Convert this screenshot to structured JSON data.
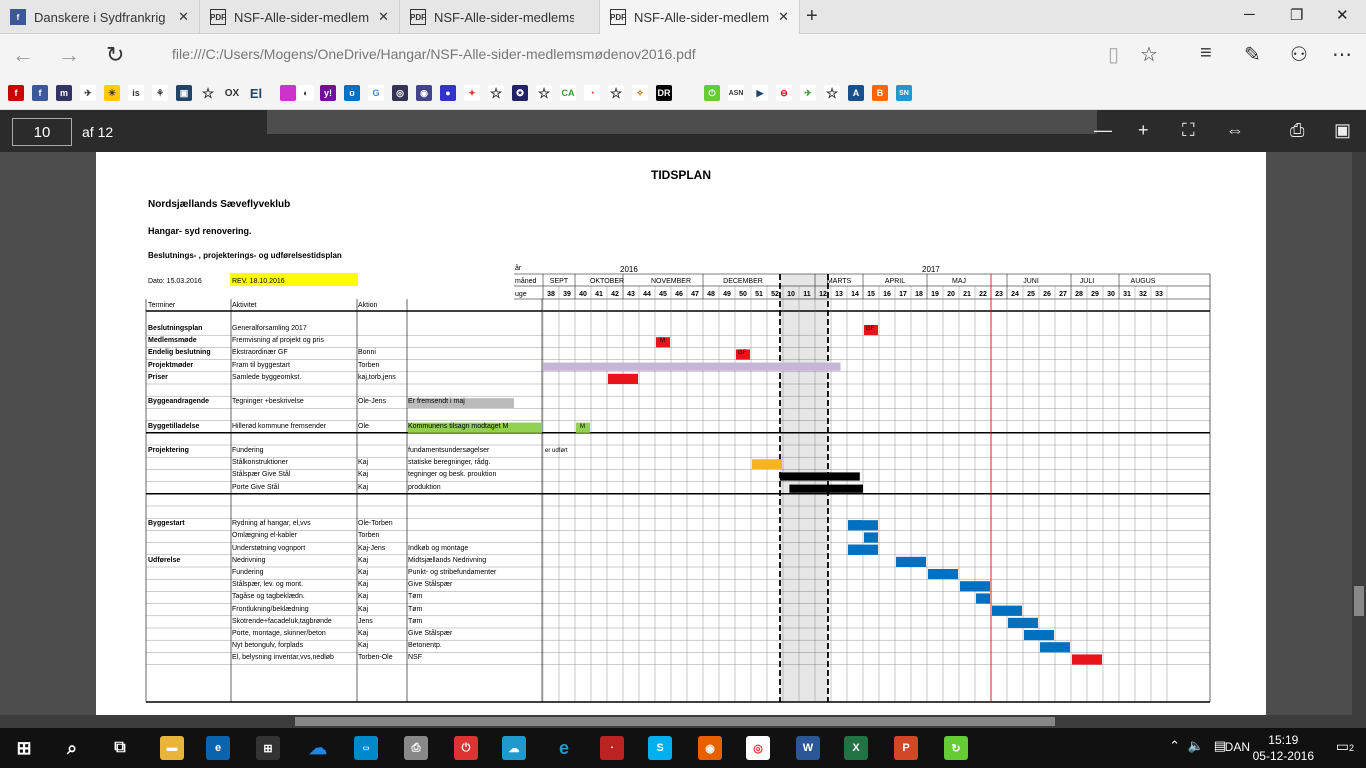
{
  "browser": {
    "tabs": [
      {
        "label": "Danskere i Sydfrankrig",
        "icon": "facebook-icon"
      },
      {
        "label": "NSF-Alle-sider-medlem",
        "icon": "pdf-icon"
      },
      {
        "label": "NSF-Alle-sider-medlemsmø",
        "icon": "pdf-icon"
      },
      {
        "label": "NSF-Alle-sider-medlem",
        "icon": "pdf-icon"
      }
    ],
    "url": "file:///C:/Users/Mogens/OneDrive/Hangar/NSF-Alle-sider-medlemsmødenov2016.pdf"
  },
  "pdf": {
    "page": "10",
    "of": "af 12"
  },
  "doc": {
    "title": "TIDSPLAN",
    "club": "Nordsjællands Sæveflyveklub",
    "project": "Hangar- syd renovering.",
    "subtitle": "Beslutnings- , projekterings- og udførelsestidsplan",
    "date": "Dato: 15.03.2016",
    "rev": "REV. 18.10.2016",
    "hdr_year": "år",
    "hdr_month": "måned",
    "hdr_week": "uge",
    "year_2016": "2016",
    "year_2017": "2017",
    "col_termin": "Terminer",
    "col_aktivitet": "Aktivitet",
    "col_aktion": "Aktion",
    "months": [
      "SEPT",
      "OKTOBER",
      "NOVEMBER",
      "DECEMBER",
      "MARTS",
      "APRIL",
      "MAJ",
      "JUNI",
      "JULI",
      "AUGUS"
    ],
    "weeks": [
      "38",
      "39",
      "40",
      "41",
      "42",
      "43",
      "44",
      "45",
      "46",
      "47",
      "48",
      "49",
      "50",
      "51",
      "52",
      "10",
      "11",
      "12",
      "13",
      "14",
      "15",
      "16",
      "17",
      "18",
      "19",
      "20",
      "21",
      "22",
      "23",
      "24",
      "25",
      "26",
      "27",
      "28",
      "29",
      "30",
      "31",
      "32",
      "33"
    ],
    "rows": [
      {
        "t": "Beslutningsplan",
        "a": "Generalforsamling 2017",
        "k": "",
        "n": ""
      },
      {
        "t": "Medlemsmøde",
        "a": "Fremvisning af projekt og pris",
        "k": "",
        "n": ""
      },
      {
        "t": "Endelig beslutning",
        "a": "Ekstraordinær GF",
        "k": "Bonni",
        "n": ""
      },
      {
        "t": "Projektmøder",
        "a": "Fram til byggestart",
        "k": "Torben",
        "n": ""
      },
      {
        "t": "Priser",
        "a": "Samlede byggeomkst.",
        "k": "kaj,torb,jens",
        "n": ""
      },
      {
        "t": "",
        "a": "",
        "k": "",
        "n": ""
      },
      {
        "t": "Byggeandragende",
        "a": "Tegninger +beskrivelse",
        "k": "Ole-Jens",
        "n": "Er fremsendt i maj"
      },
      {
        "t": "",
        "a": "",
        "k": "",
        "n": ""
      },
      {
        "t": "Byggetilladelse",
        "a": "Hillerød kommune fremsender",
        "k": "Ole",
        "n": "Kommunens tilsagn modtaget M"
      },
      {
        "t": "",
        "a": "",
        "k": "",
        "n": ""
      },
      {
        "t": "Projektering",
        "a": "Fundering",
        "k": "",
        "n": "fundamentsundersøgelser"
      },
      {
        "t": "",
        "a": "Stålkonstruktioner",
        "k": "Kaj",
        "n": "statiske beregninger, rådg."
      },
      {
        "t": "",
        "a": "Stålspær Give Stål",
        "k": "Kaj",
        "n": "tegninger og besk. prouktion"
      },
      {
        "t": "",
        "a": "Porte Give Stål",
        "k": "Kaj",
        "n": "produktion"
      },
      {
        "t": "",
        "a": "",
        "k": "",
        "n": ""
      },
      {
        "t": "",
        "a": "",
        "k": "",
        "n": ""
      },
      {
        "t": "Byggestart",
        "a": "Rydning af hangar, el,vvs",
        "k": "Ole-Torben",
        "n": ""
      },
      {
        "t": "",
        "a": "Omlægning el-kabler",
        "k": "Torben",
        "n": ""
      },
      {
        "t": "",
        "a": "Understøtning vognport",
        "k": "Kaj-Jens",
        "n": "Indkøb og montage"
      },
      {
        "t": "Udførelse",
        "a": "Nedrivning",
        "k": "Kaj",
        "n": "Midtsjællands Nedrivning"
      },
      {
        "t": "",
        "a": "Fundering",
        "k": "Kaj",
        "n": "Punkt- og stribefundamenter"
      },
      {
        "t": "",
        "a": "Stålspær, lev. og mont.",
        "k": "Kaj",
        "n": "Give Stålspær"
      },
      {
        "t": "",
        "a": "Tagåse og tagbeklædn.",
        "k": "Kaj",
        "n": "Tøm"
      },
      {
        "t": "",
        "a": "Frontlukning/beklædning",
        "k": "Kaj",
        "n": "Tøm"
      },
      {
        "t": "",
        "a": "Skotrende+facadeluk,tagbrønde",
        "k": "Jens",
        "n": "Tøm"
      },
      {
        "t": "",
        "a": "Porte, montage, skinner/beton",
        "k": "Kaj",
        "n": "Give Stålspær"
      },
      {
        "t": "",
        "a": "Nyt betongulv, forplads",
        "k": "Kaj",
        "n": "Betonentp."
      },
      {
        "t": "",
        "a": "El, belysning inventar,vvs,nedløb",
        "k": "Torben-Ole",
        "n": "NSF"
      }
    ],
    "cell_labels": {
      "mm": "M",
      "eb": "GF",
      "gf": "GF",
      "m2": "M",
      "udfort": "er udført"
    }
  },
  "taskbar": {
    "lang": "DAN",
    "time": "15:19",
    "date": "05-12-2016",
    "notif": "2"
  },
  "colors": {
    "red": "#e8141b",
    "blue": "#0070c0",
    "green": "#92d050",
    "yellow": "#ffff00",
    "orange": "#f5b51c",
    "lilac": "#c5b6d8"
  }
}
